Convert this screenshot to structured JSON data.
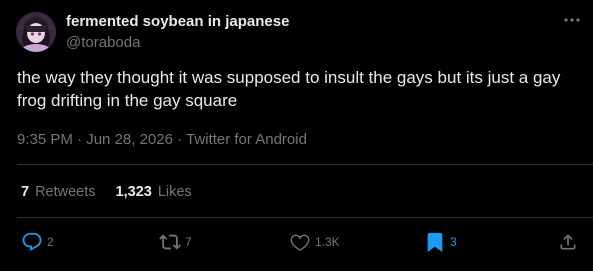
{
  "author": {
    "display_name": "fermented soybean in japanese",
    "handle": "@toraboda"
  },
  "tweet": {
    "text": "the way they thought it was supposed to insult the gays but its just a gay frog drifting in the gay square"
  },
  "meta": {
    "time": "9:35 PM",
    "separator1": " · ",
    "date": "Jun 28, 2026",
    "separator2": " · ",
    "source": "Twitter for Android"
  },
  "stats": {
    "retweets_count": "7",
    "retweets_label": "Retweets",
    "likes_count": "1,323",
    "likes_label": "Likes"
  },
  "actions": {
    "reply_count": "2",
    "retweet_count": "7",
    "like_count": "1.3K",
    "bookmark_count": "3"
  },
  "icons": {
    "more": "more-horizontal-icon",
    "reply": "reply-icon",
    "retweet": "retweet-icon",
    "like": "heart-icon",
    "bookmark": "bookmark-icon",
    "share": "share-icon"
  },
  "colors": {
    "background": "#000000",
    "text_primary": "#e7e9ea",
    "text_secondary": "#71767b",
    "accent_blue": "#1d9bf0",
    "divider": "#2f3336"
  }
}
